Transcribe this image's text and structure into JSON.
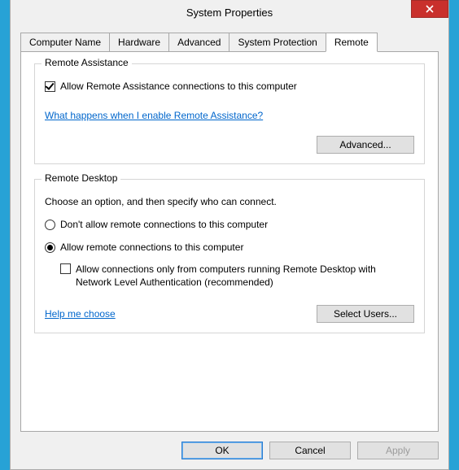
{
  "window": {
    "title": "System Properties"
  },
  "tabs": [
    {
      "label": "Computer Name"
    },
    {
      "label": "Hardware"
    },
    {
      "label": "Advanced"
    },
    {
      "label": "System Protection"
    },
    {
      "label": "Remote"
    }
  ],
  "remoteAssistance": {
    "legend": "Remote Assistance",
    "allowLabel": "Allow Remote Assistance connections to this computer",
    "helpLink": "What happens when I enable Remote Assistance?",
    "advancedBtn": "Advanced..."
  },
  "remoteDesktop": {
    "legend": "Remote Desktop",
    "intro": "Choose an option, and then specify who can connect.",
    "optDisallow": "Don't allow remote connections to this computer",
    "optAllow": "Allow remote connections to this computer",
    "nlaLabel": "Allow connections only from computers running Remote Desktop with Network Level Authentication (recommended)",
    "helpLink": "Help me choose",
    "selectUsersBtn": "Select Users..."
  },
  "footer": {
    "ok": "OK",
    "cancel": "Cancel",
    "apply": "Apply"
  }
}
